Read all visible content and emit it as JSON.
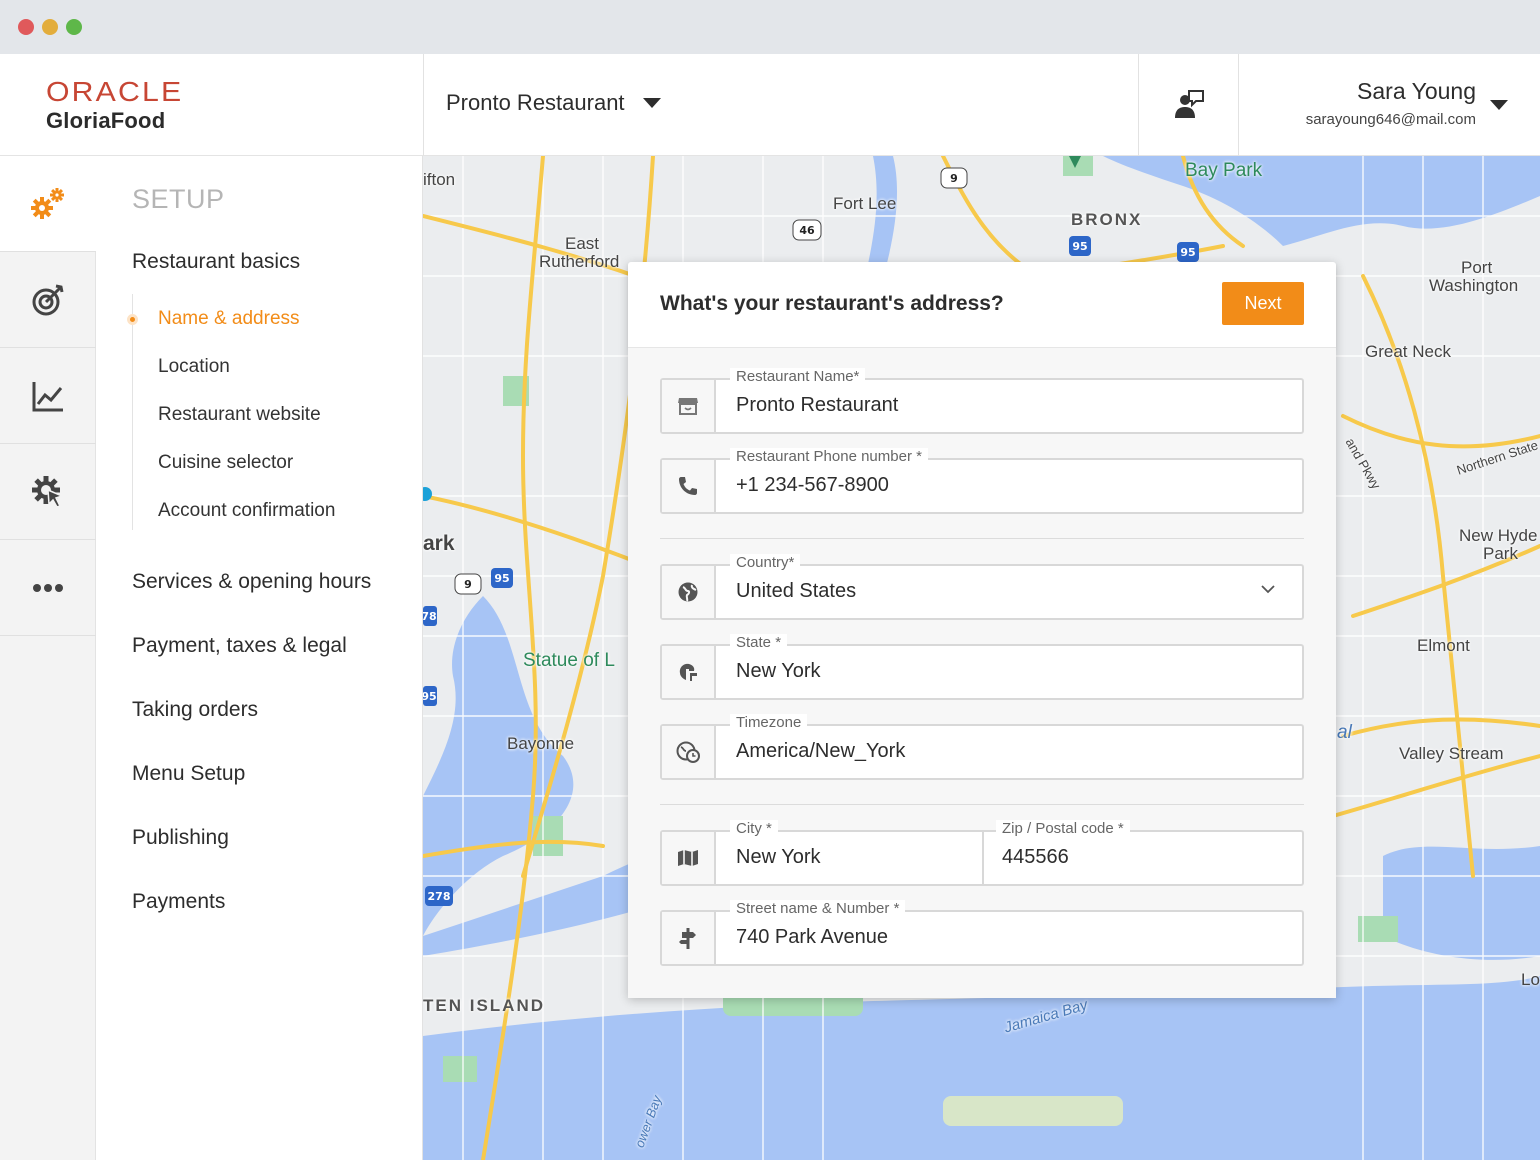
{
  "app": {
    "brand_top": "ORACLE",
    "brand_bottom": "GloriaFood",
    "restaurant_selected": "Pronto Restaurant"
  },
  "user": {
    "name": "Sara Young",
    "email": "sarayoung646@mail.com"
  },
  "rail": {
    "items": [
      {
        "icon": "setup-gears-icon",
        "active": true
      },
      {
        "icon": "marketing-target-icon",
        "active": false
      },
      {
        "icon": "reports-chart-icon",
        "active": false
      },
      {
        "icon": "settings-cursor-gear-icon",
        "active": false
      },
      {
        "icon": "more-dots-icon",
        "active": false
      }
    ]
  },
  "setup": {
    "title": "SETUP",
    "sections": [
      {
        "label": "Restaurant basics"
      },
      {
        "label": "Services & opening hours"
      },
      {
        "label": "Payment, taxes & legal"
      },
      {
        "label": "Taking orders"
      },
      {
        "label": "Menu Setup"
      },
      {
        "label": "Publishing"
      },
      {
        "label": "Payments"
      }
    ],
    "sub_items": [
      {
        "label": "Name & address",
        "active": true
      },
      {
        "label": "Location",
        "active": false
      },
      {
        "label": "Restaurant website",
        "active": false
      },
      {
        "label": "Cuisine selector",
        "active": false
      },
      {
        "label": "Account confirmation",
        "active": false
      }
    ]
  },
  "map": {
    "labels": [
      "ifton",
      "East",
      "Rutherford",
      "Fort Lee",
      "BRONX",
      "Bay Park",
      "Port",
      "Washington",
      "Great Neck",
      "ark",
      "Statue of L",
      "Bayonne",
      "TEN ISLAND",
      "Jamaica Bay",
      "Elmont",
      "New Hyde",
      "Park",
      "Valley Stream",
      "Lo",
      "al",
      "Northern State",
      "and Pkwy",
      "ower Bay"
    ],
    "shields": [
      "9",
      "46",
      "95",
      "95",
      "9",
      "95",
      "78",
      "95",
      "278"
    ]
  },
  "form": {
    "title": "What's your restaurant's address?",
    "next_label": "Next",
    "restaurant_name": {
      "label": "Restaurant Name*",
      "value": "Pronto Restaurant"
    },
    "phone": {
      "label": "Restaurant Phone number *",
      "value": "+1 234-567-8900"
    },
    "country": {
      "label": "Country*",
      "value": "United States"
    },
    "state": {
      "label": "State *",
      "value": "New York"
    },
    "timezone": {
      "label": "Timezone",
      "value": "America/New_York"
    },
    "city": {
      "label": "City *",
      "value": "New York"
    },
    "zip": {
      "label": "Zip / Postal code *",
      "value": "445566"
    },
    "street": {
      "label": "Street name & Number *",
      "value": "740 Park Avenue"
    }
  },
  "colors": {
    "accent": "#f28c18",
    "oracle_red": "#c74634",
    "map_water": "#a7c4f5",
    "map_park": "#a9dcb4",
    "map_road": "#f7c94b"
  }
}
